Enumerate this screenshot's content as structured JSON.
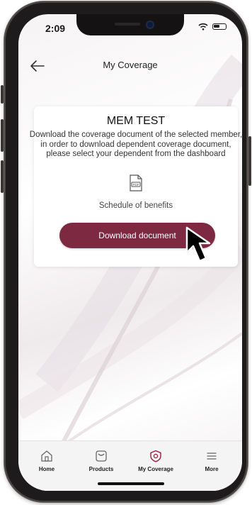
{
  "status_bar": {
    "time": "2:09"
  },
  "header": {
    "title": "My Coverage"
  },
  "card": {
    "title": "MEM TEST",
    "description": "Download the coverage document of the selected member, in order to download dependent coverage document, please select your dependent from the dashboard",
    "document_label": "Schedule of benefits",
    "pdf_icon_text": "PDF",
    "download_button": "Download document"
  },
  "tabs": [
    {
      "label": "Home",
      "icon": "home-icon"
    },
    {
      "label": "Products",
      "icon": "products-icon"
    },
    {
      "label": "My Coverage",
      "icon": "shield-icon",
      "active": true
    },
    {
      "label": "More",
      "icon": "menu-icon"
    }
  ],
  "colors": {
    "accent": "#7d2942",
    "tab_active": "#9b1e3f"
  }
}
